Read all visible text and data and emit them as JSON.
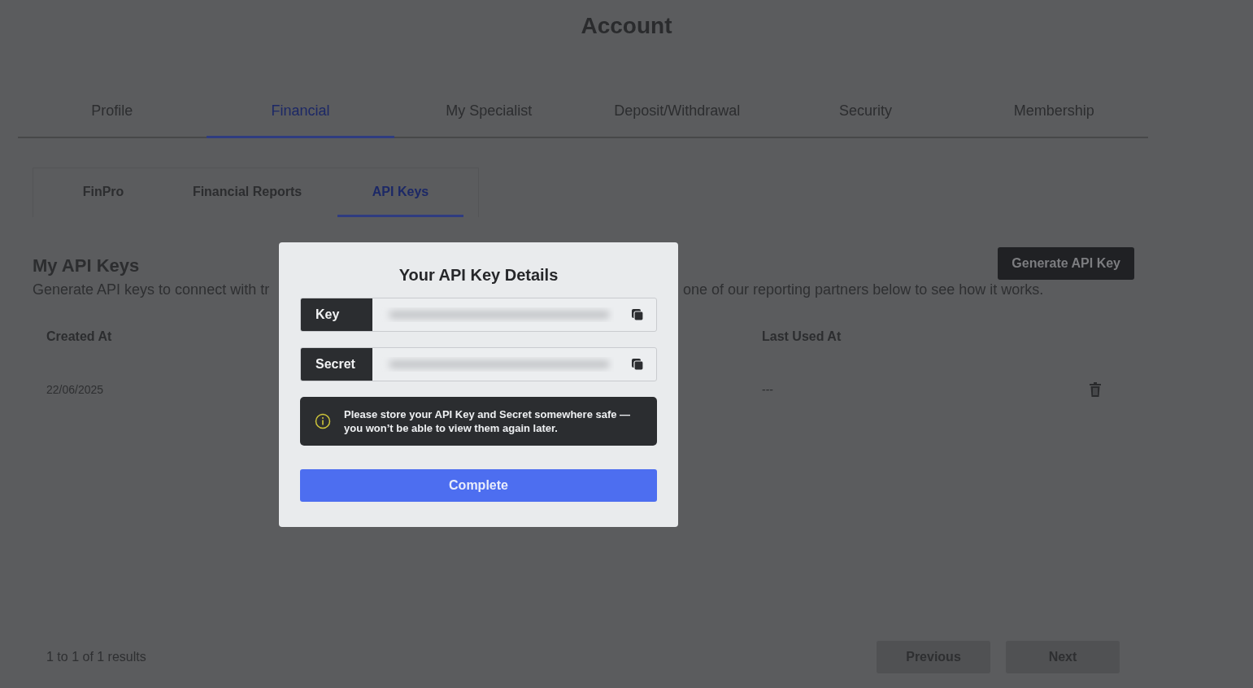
{
  "page": {
    "title": "Account"
  },
  "tabs": [
    {
      "label": "Profile",
      "selected": false
    },
    {
      "label": "Financial",
      "selected": true
    },
    {
      "label": "My Specialist",
      "selected": false
    },
    {
      "label": "Deposit/Withdrawal",
      "selected": false
    },
    {
      "label": "Security",
      "selected": false
    },
    {
      "label": "Membership",
      "selected": false
    }
  ],
  "subtabs": [
    {
      "label": "FinPro",
      "selected": false
    },
    {
      "label": "Financial Reports",
      "selected": false
    },
    {
      "label": "API Keys",
      "selected": true
    }
  ],
  "section": {
    "heading": "My API Keys",
    "description_visible_start": "Generate API keys to connect with tr",
    "description_visible_end": "one of our reporting partners below to see how it works.",
    "generate_button": "Generate API Key"
  },
  "table": {
    "columns": [
      "Created At",
      "Last Used At"
    ],
    "rows": [
      {
        "created_at": "22/06/2025",
        "last_used_at": "---"
      }
    ]
  },
  "pagination": {
    "summary": "1 to 1 of 1 results",
    "previous": "Previous",
    "next": "Next",
    "previous_disabled": true,
    "next_disabled": true
  },
  "modal": {
    "title": "Your API Key Details",
    "fields": [
      {
        "label": "Key"
      },
      {
        "label": "Secret"
      }
    ],
    "notice": "Please store your API Key and Secret somewhere safe — you won’t be able to view them again later.",
    "button": "Complete"
  }
}
